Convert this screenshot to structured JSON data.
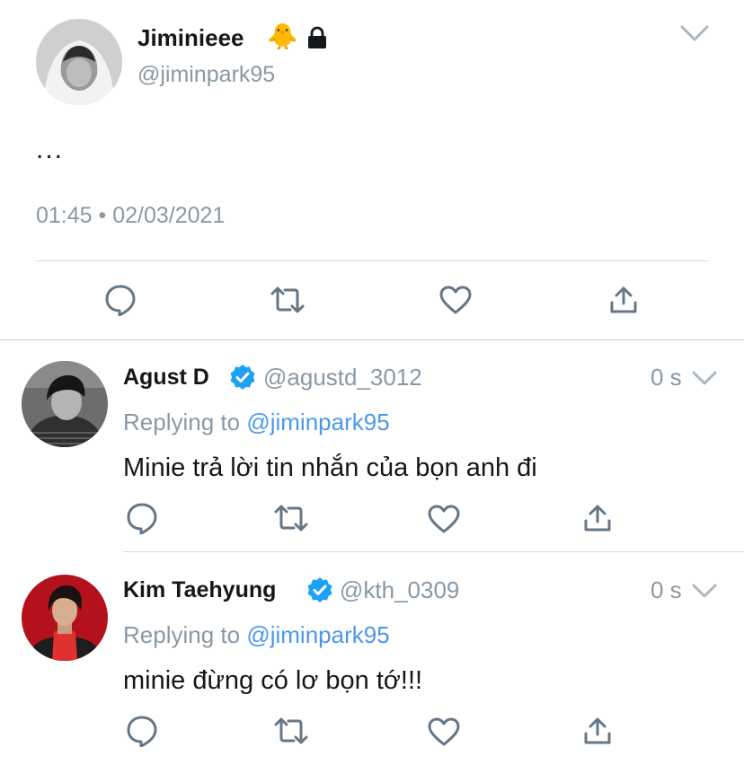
{
  "main_tweet": {
    "display_name": "Jiminieee",
    "emoji": "🐥",
    "handle": "@jiminpark95",
    "text": "...",
    "timestamp": "01:45 • 02/03/2021"
  },
  "replies": [
    {
      "display_name": "Agust D",
      "handle": "@agustd_3012",
      "time": "0 s",
      "replying_prefix": "Replying to",
      "replying_to": "@jiminpark95",
      "text": "Minie trả lời tin nhắn của bọn anh đi"
    },
    {
      "display_name": "Kim Taehyung",
      "handle": "@kth_0309",
      "time": "0 s",
      "replying_prefix": "Replying to",
      "replying_to": "@jiminpark95",
      "text": "minie đừng có lơ bọn tớ!!!"
    }
  ],
  "icons": {
    "action_bar": [
      "reply-icon",
      "retweet-icon",
      "like-icon",
      "share-icon"
    ],
    "header": [
      "chevron-down-icon",
      "lock-icon",
      "verified-icon"
    ]
  },
  "colors": {
    "icon_gray": "#657786",
    "muted_text": "#8899a6",
    "link_blue": "#4a99e9",
    "verified_blue": "#1da1f2",
    "divider": "#d5d9dd"
  }
}
